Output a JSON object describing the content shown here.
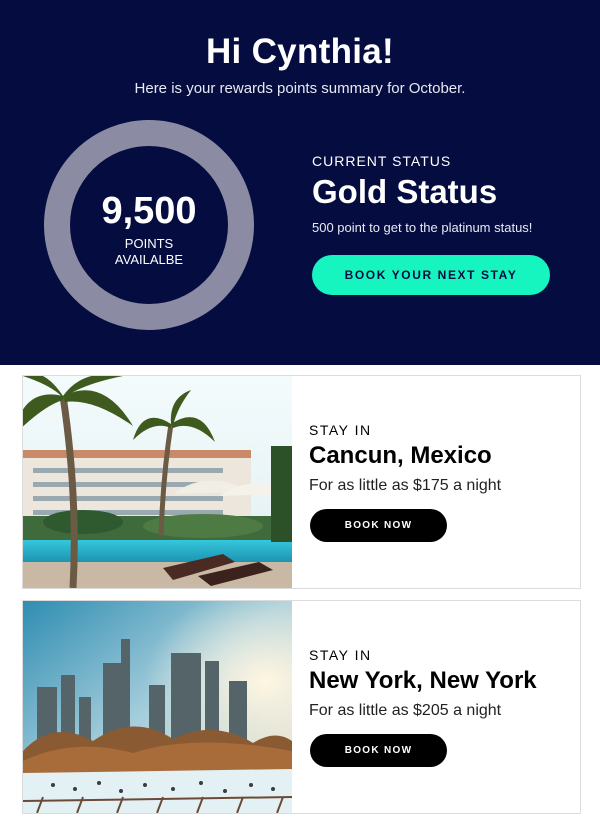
{
  "header": {
    "greeting": "Hi Cynthia!",
    "subtitle": "Here is your rewards points summary for October."
  },
  "points": {
    "value": "9,500",
    "label_line1": "POINTS",
    "label_line2": "AVAILALBE"
  },
  "status": {
    "kicker": "CURRENT STATUS",
    "title": "Gold Status",
    "note": "500 point to get to the platinum status!",
    "cta_label": "BOOK YOUR NEXT STAY"
  },
  "stays": [
    {
      "kicker": "STAY IN",
      "title": "Cancun, Mexico",
      "price": "For as little as $175 a night",
      "button": "BOOK NOW"
    },
    {
      "kicker": "STAY IN",
      "title": "New York, New York",
      "price": "For as little as $205 a night",
      "button": "BOOK NOW"
    }
  ],
  "colors": {
    "hero_bg": "#050d40",
    "ring": "#8b8ca3",
    "accent": "#16f5c0",
    "button_dark": "#000000"
  }
}
